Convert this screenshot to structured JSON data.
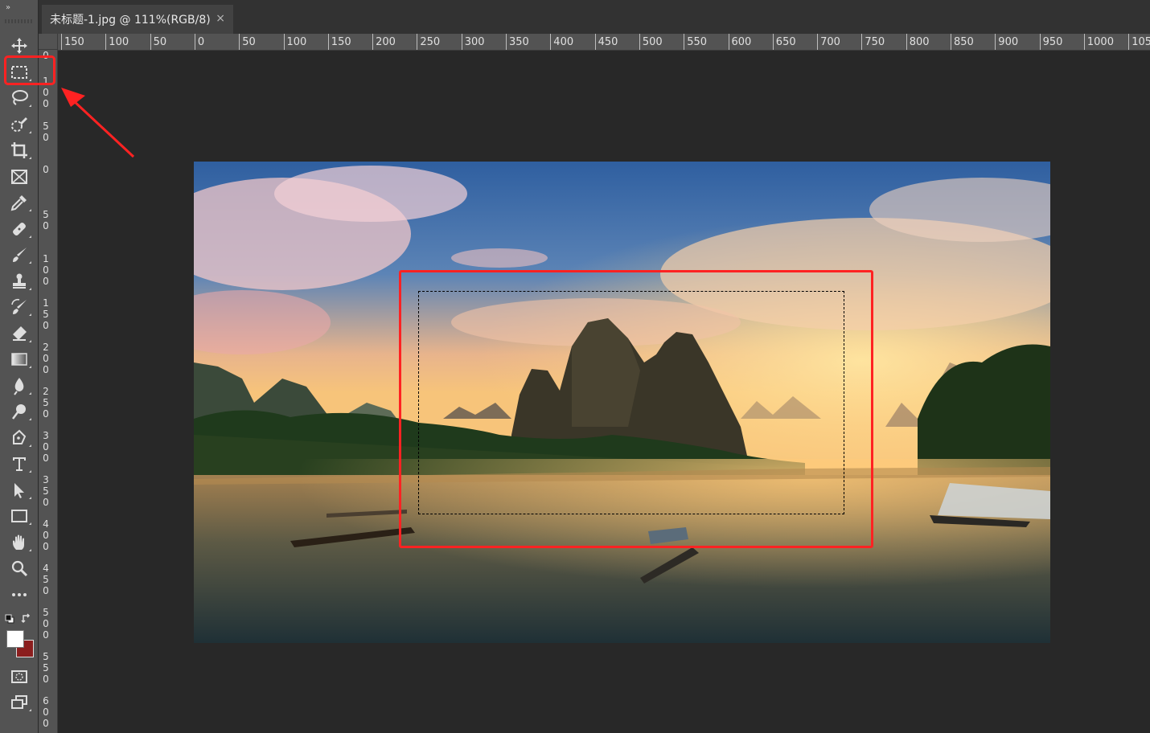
{
  "document_tab": {
    "title": "未标题-1.jpg @ 111%(RGB/8)",
    "close_label": "×"
  },
  "toolbar": {
    "collapse_label": "»",
    "tools": [
      {
        "name": "move-tool-icon"
      },
      {
        "name": "rectangular-marquee-tool-icon",
        "selected": true
      },
      {
        "name": "lasso-tool-icon"
      },
      {
        "name": "quick-selection-tool-icon"
      },
      {
        "name": "crop-tool-icon"
      },
      {
        "name": "frame-tool-icon"
      },
      {
        "name": "eyedropper-tool-icon"
      },
      {
        "name": "healing-brush-tool-icon"
      },
      {
        "name": "brush-tool-icon"
      },
      {
        "name": "clone-stamp-tool-icon"
      },
      {
        "name": "history-brush-tool-icon"
      },
      {
        "name": "eraser-tool-icon"
      },
      {
        "name": "gradient-tool-icon"
      },
      {
        "name": "blur-tool-icon"
      },
      {
        "name": "dodge-tool-icon"
      },
      {
        "name": "pen-tool-icon"
      },
      {
        "name": "type-tool-icon",
        "glyph": "T"
      },
      {
        "name": "path-selection-tool-icon"
      },
      {
        "name": "rectangle-tool-icon"
      },
      {
        "name": "hand-tool-icon"
      },
      {
        "name": "zoom-tool-icon"
      },
      {
        "name": "more-tools-icon",
        "glyph": "•••"
      }
    ],
    "foreground_color": "#ffffff",
    "background_color": "#8b1e1e"
  },
  "rulers": {
    "horizontal": [
      "150",
      "100",
      "50",
      "0",
      "50",
      "100",
      "150",
      "200",
      "250",
      "300",
      "350",
      "400",
      "450",
      "500",
      "550",
      "600",
      "650",
      "700",
      "750",
      "800",
      "850",
      "900",
      "950",
      "1000",
      "105"
    ],
    "vertical": [
      "0",
      "100",
      "50",
      "0",
      "50",
      "100",
      "150",
      "200",
      "250",
      "300",
      "350",
      "400",
      "450",
      "500",
      "550",
      "600"
    ]
  },
  "annotation_color": "#ff2222"
}
